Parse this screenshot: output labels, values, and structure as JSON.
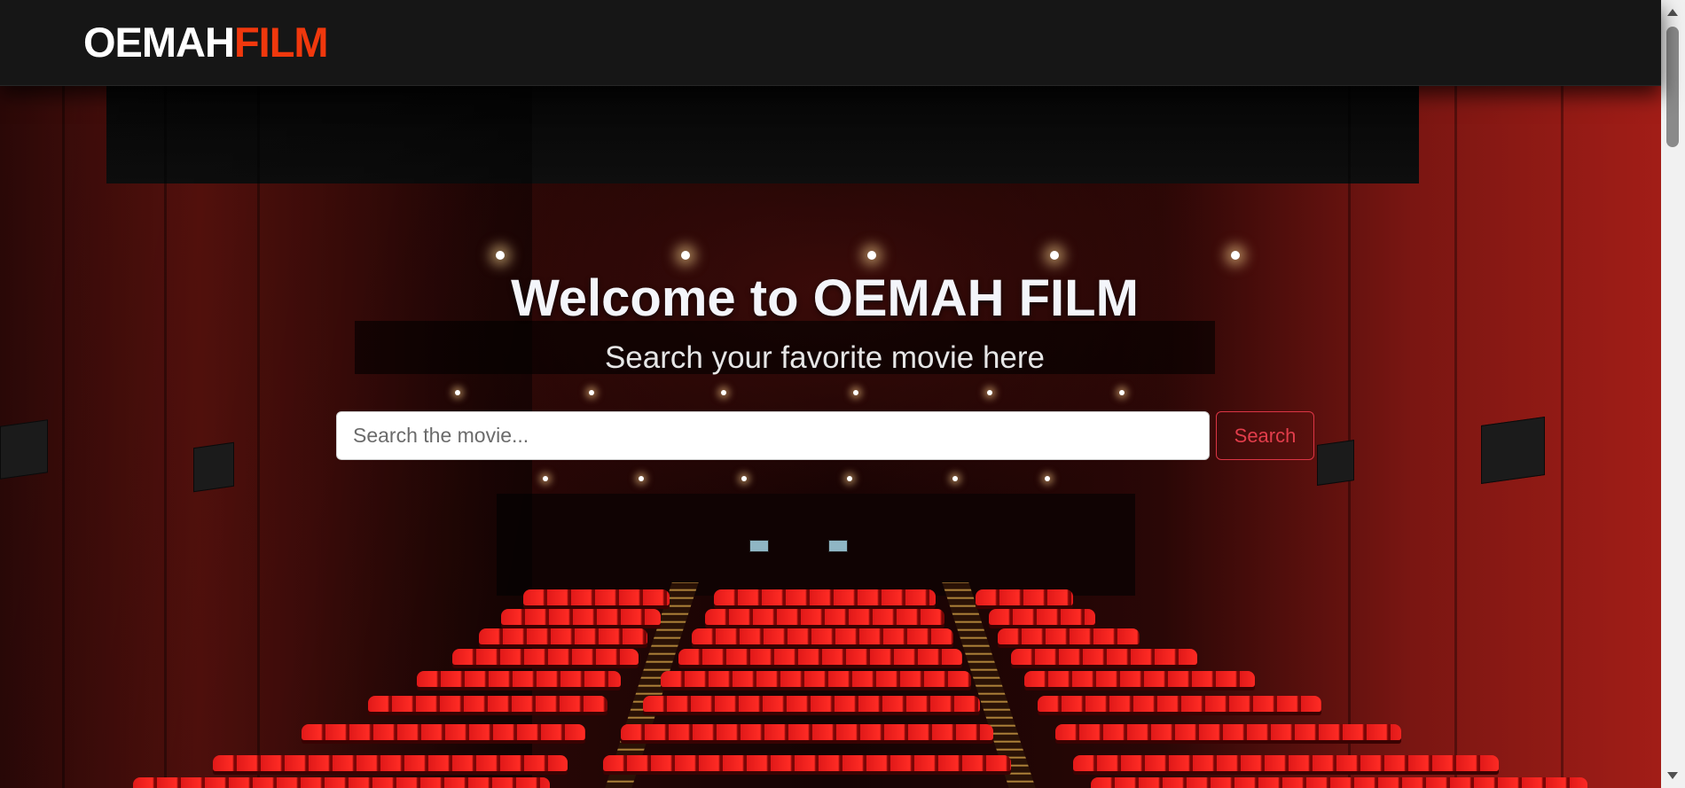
{
  "navbar": {
    "brand_part1": "OEMAH",
    "brand_part2": "FILM",
    "brand_colors": {
      "part1": "#ffffff",
      "part2": "#f0380d"
    }
  },
  "hero": {
    "title": "Welcome to OEMAH FILM",
    "subtitle": "Search your favorite movie here",
    "background": "cinema-auditorium-red-seats"
  },
  "search": {
    "placeholder": "Search the movie...",
    "value": "",
    "button_label": "Search",
    "button_color": "#dc3545"
  },
  "scrollbar": {
    "up_icon": "chevron-up-icon",
    "down_icon": "chevron-down-icon"
  }
}
